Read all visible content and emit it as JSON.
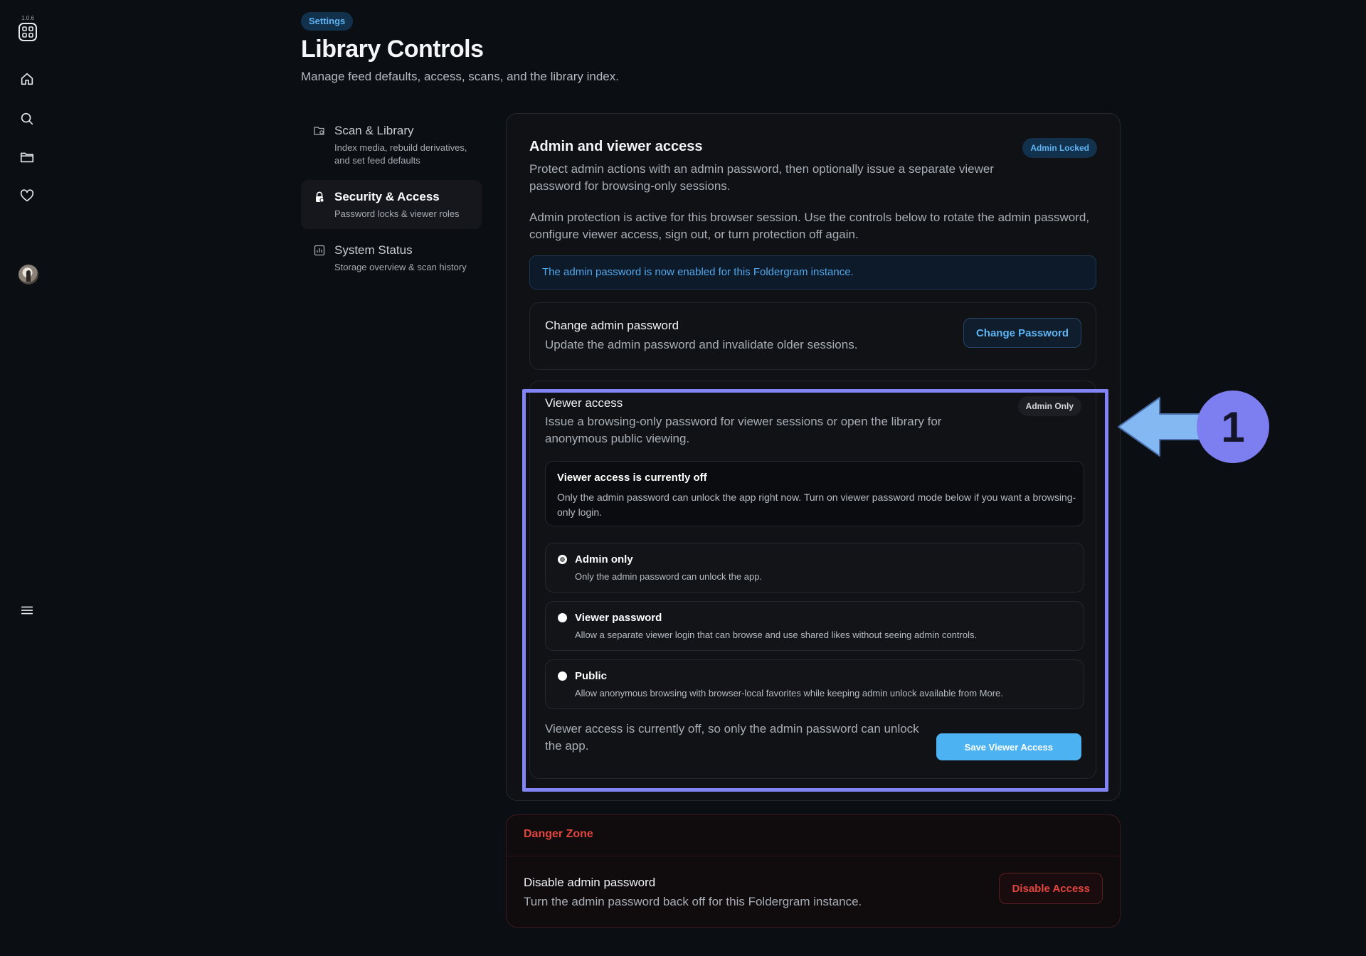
{
  "app": {
    "version": "1.0.6"
  },
  "header": {
    "breadcrumb": "Settings",
    "title": "Library Controls",
    "subtitle": "Manage feed defaults, access, scans, and the library index."
  },
  "section_nav": [
    {
      "label": "Scan & Library",
      "desc": "Index media, rebuild derivatives, and set feed defaults",
      "icon": "folder-scan-icon",
      "active": false
    },
    {
      "label": "Security & Access",
      "desc": "Password locks & viewer roles",
      "icon": "lock-icon",
      "active": true
    },
    {
      "label": "System Status",
      "desc": "Storage overview & scan history",
      "icon": "chart-icon",
      "active": false
    }
  ],
  "access_card": {
    "title": "Admin and viewer access",
    "badge": "Admin Locked",
    "intro": "Protect admin actions with an admin password, then optionally issue a separate viewer password for browsing-only sessions.",
    "active_note": "Admin protection is active for this browser session. Use the controls below to rotate the admin password, configure viewer access, sign out, or turn protection off again.",
    "notice": "The admin password is now enabled for this Foldergram instance.",
    "change_password": {
      "title": "Change admin password",
      "desc": "Update the admin password and invalidate older sessions.",
      "button": "Change Password"
    },
    "viewer_access": {
      "title": "Viewer access",
      "badge": "Admin Only",
      "desc": "Issue a browsing-only password for viewer sessions or open the library for anonymous public viewing.",
      "status_title": "Viewer access is currently off",
      "status_desc": "Only the admin password can unlock the app right now. Turn on viewer password mode below if you want a browsing-only login.",
      "options": [
        {
          "label": "Admin only",
          "desc": "Only the admin password can unlock the app.",
          "selected": true
        },
        {
          "label": "Viewer password",
          "desc": "Allow a separate viewer login that can browse and use shared likes without seeing admin controls.",
          "selected": false
        },
        {
          "label": "Public",
          "desc": "Allow anonymous browsing with browser-local favorites while keeping admin unlock available from More.",
          "selected": false
        }
      ],
      "footer_note": "Viewer access is currently off, so only the admin password can unlock the app.",
      "save_button": "Save Viewer Access"
    }
  },
  "danger_zone": {
    "heading": "Danger Zone",
    "title": "Disable admin password",
    "desc": "Turn the admin password back off for this Foldergram instance.",
    "button": "Disable Access"
  },
  "callout": {
    "number": "1"
  },
  "colors": {
    "accent": "#4cb2f2",
    "danger": "#e2453c",
    "highlight": "#8184f2",
    "callout": "#7d7ff0"
  }
}
